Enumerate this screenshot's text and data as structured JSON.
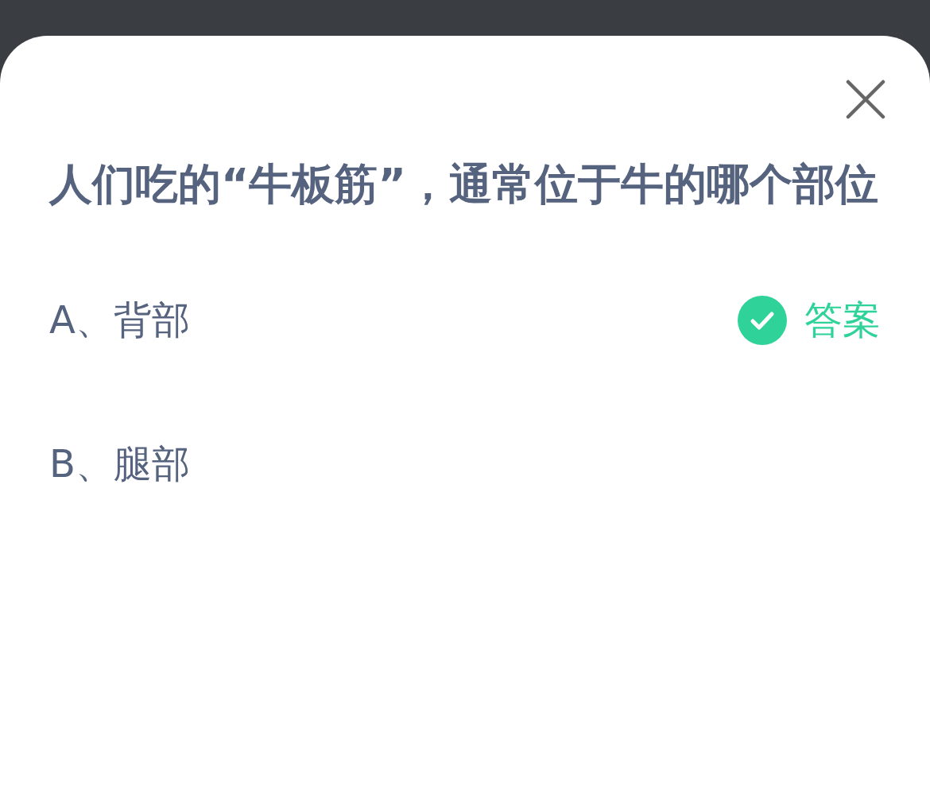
{
  "question": "人们吃的“牛板筋”，通常位于牛的哪个部位",
  "answer_badge": "答案",
  "options": [
    {
      "label": "A、背部",
      "correct": true
    },
    {
      "label": "B、腿部",
      "correct": false
    }
  ]
}
